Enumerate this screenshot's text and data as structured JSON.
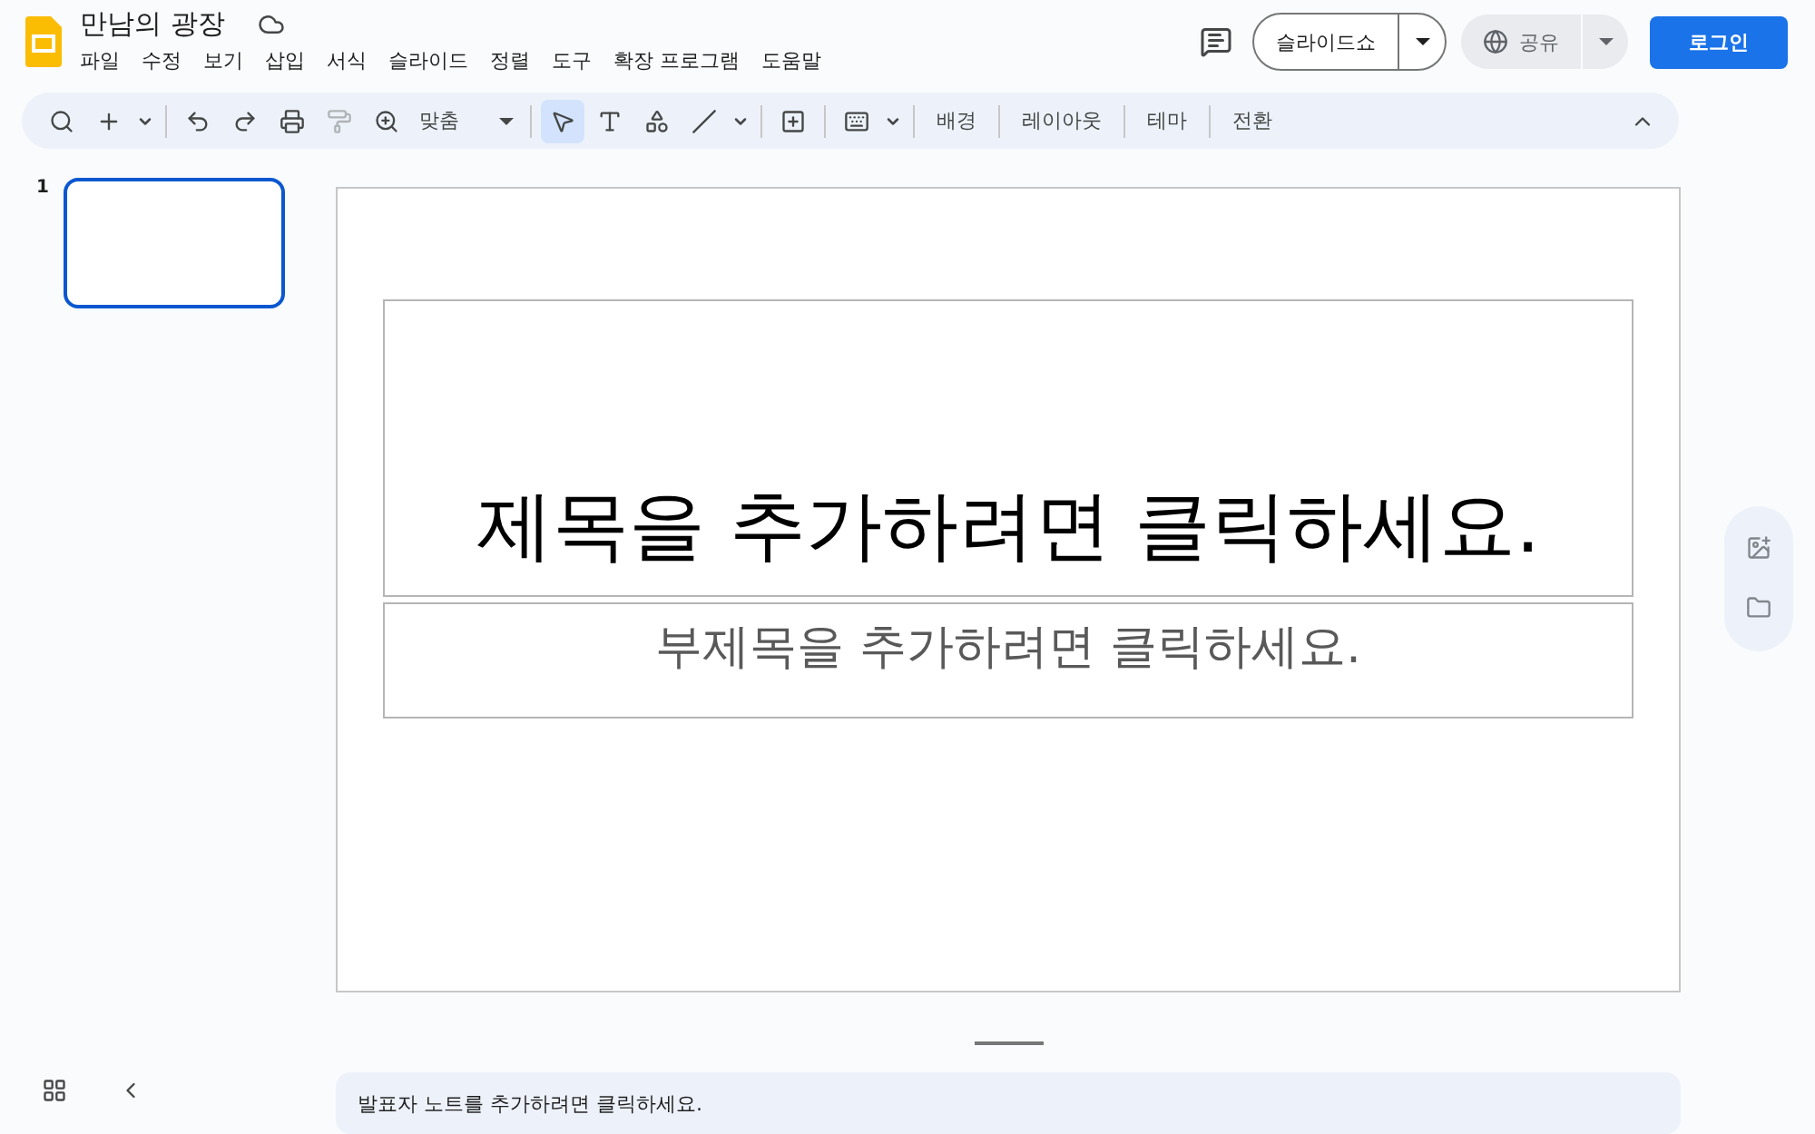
{
  "document": {
    "title": "만남의 광장"
  },
  "menu": [
    "파일",
    "수정",
    "보기",
    "삽입",
    "서식",
    "슬라이드",
    "정렬",
    "도구",
    "확장 프로그램",
    "도움말"
  ],
  "header_buttons": {
    "slideshow": "슬라이드쇼",
    "share": "공유",
    "login": "로그인"
  },
  "toolbar": {
    "tools": [
      {
        "selected": false,
        "disabled": false
      },
      {
        "selected": false,
        "disabled": false
      },
      {
        "selected": false,
        "disabled": false
      },
      {
        "selected": false,
        "disabled": false
      },
      {
        "selected": false,
        "disabled": false
      },
      {
        "selected": false,
        "disabled": true
      },
      {
        "selected": false,
        "disabled": false
      },
      {
        "selected": true,
        "disabled": false
      },
      {
        "selected": false,
        "disabled": false
      },
      {
        "selected": false,
        "disabled": false
      },
      {
        "selected": false,
        "disabled": false
      },
      {
        "selected": false,
        "disabled": false
      },
      {
        "selected": false,
        "disabled": false
      }
    ],
    "zoom": "맞춤",
    "text_buttons": [
      "배경",
      "레이아웃",
      "테마",
      "전환"
    ]
  },
  "slides": [
    {
      "number": "1",
      "selected": true
    }
  ],
  "slide": {
    "title_placeholder": "제목을 추가하려면 클릭하세요.",
    "subtitle_placeholder": "부제목을 추가하려면 클릭하세요."
  },
  "notes": {
    "placeholder": "발표자 노트를 추가하려면 클릭하세요."
  }
}
